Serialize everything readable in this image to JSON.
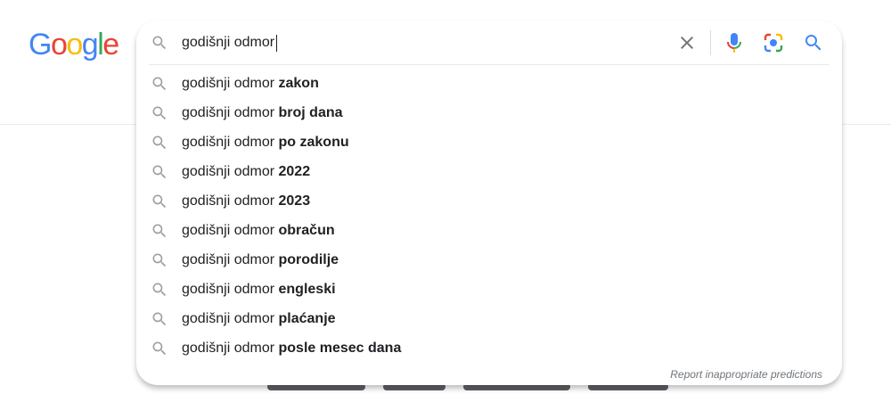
{
  "logo": {
    "letters": [
      "G",
      "o",
      "o",
      "g",
      "l",
      "e"
    ],
    "colors": [
      "#4285F4",
      "#EA4335",
      "#FBBC05",
      "#4285F4",
      "#34A853",
      "#EA4335"
    ]
  },
  "search": {
    "query": "godišnji odmor"
  },
  "suggestions": [
    {
      "prefix": "godišnji odmor ",
      "completion": "zakon"
    },
    {
      "prefix": "godišnji odmor ",
      "completion": "broj dana"
    },
    {
      "prefix": "godišnji odmor ",
      "completion": "po zakonu"
    },
    {
      "prefix": "godišnji odmor ",
      "completion": "2022"
    },
    {
      "prefix": "godišnji odmor ",
      "completion": "2023"
    },
    {
      "prefix": "godišnji odmor ",
      "completion": "obračun"
    },
    {
      "prefix": "godišnji odmor ",
      "completion": "porodilje"
    },
    {
      "prefix": "godišnji odmor ",
      "completion": "engleski"
    },
    {
      "prefix": "godišnji odmor ",
      "completion": "plaćanje"
    },
    {
      "prefix": "godišnji odmor ",
      "completion": "posle mesec dana"
    }
  ],
  "report_link": "Report inappropriate predictions",
  "icons": {
    "search": "search-icon",
    "clear": "close-icon",
    "mic": "microphone-icon",
    "lens": "camera-lens-icon",
    "submit": "search-icon"
  },
  "colors": {
    "text": "#202124",
    "icon_gray": "#9aa0a6",
    "blue": "#4285F4",
    "red": "#EA4335",
    "yellow": "#FBBC05",
    "green": "#34A853",
    "muted": "#70757a"
  }
}
